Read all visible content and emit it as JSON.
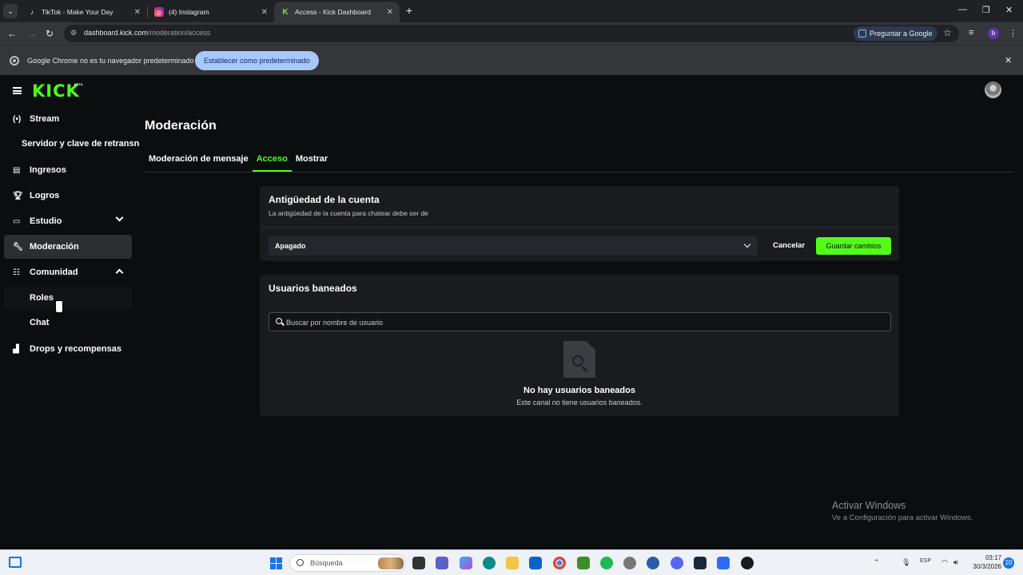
{
  "browser": {
    "tabs": [
      {
        "title": "TikTok - Make Your Day",
        "icon": "tiktok-icon"
      },
      {
        "title": "(4) Instagram",
        "icon": "instagram-icon"
      },
      {
        "title": "Access - Kick Dashboard",
        "icon": "kick-icon",
        "active": true
      }
    ],
    "url_host": "dashboard.kick.com",
    "url_path": "/moderation/access",
    "ask_google": "Preguntar a Google",
    "profile_letter": "b",
    "infobar_text": "Google Chrome no es tu navegador predeterminado",
    "infobar_button": "Establecer como predeterminado"
  },
  "kick": {
    "logo": "KICK",
    "beta": "BETA",
    "nav": {
      "stream": "Stream",
      "server_key": "Servidor y clave de retransn",
      "ingresos": "Ingresos",
      "logros": "Logros",
      "estudio": "Estudio",
      "moderacion": "Moderación",
      "comunidad": "Comunidad",
      "roles": "Roles",
      "chat": "Chat",
      "drops": "Drops y recompensas"
    },
    "page_title": "Moderación",
    "tabs": {
      "mensaje": "Moderación de mensaje",
      "acceso": "Acceso",
      "mostrar": "Mostrar"
    },
    "account_age": {
      "title": "Antigüedad de la cuenta",
      "subtitle": "La antigüedad de la cuenta para chatear debe ser de",
      "selected": "Apagado",
      "cancel": "Cancelar",
      "save": "Guardar cambios"
    },
    "banned": {
      "title": "Usuarios baneados",
      "search_placeholder": "Buscar por nombre de usuario",
      "empty_title": "No hay usuarios baneados",
      "empty_sub": "Este canal no tiene usuarios baneados."
    },
    "accent": "#53fc18"
  },
  "watermark": {
    "line1": "Activar Windows",
    "line2": "Ve a Configuración para activar Windows."
  },
  "taskbar": {
    "search": "Búsqueda",
    "lang": "ESP",
    "time": "03:17",
    "date": "30/3/2026",
    "notifications": "10"
  }
}
